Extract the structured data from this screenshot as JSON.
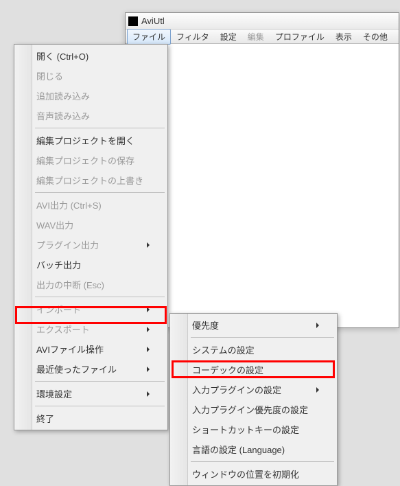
{
  "app": {
    "title": "AviUtl"
  },
  "menubar": {
    "file": "ファイル",
    "filter": "フィルタ",
    "settings": "設定",
    "edit": "編集",
    "profile": "プロファイル",
    "view": "表示",
    "other": "その他"
  },
  "menu1": {
    "open": "開く (Ctrl+O)",
    "close": "閉じる",
    "addload": "追加読み込み",
    "audioload": "音声読み込み",
    "projopen": "編集プロジェクトを開く",
    "projsave": "編集プロジェクトの保存",
    "projoverwrite": "編集プロジェクトの上書き",
    "aviout": "AVI出力 (Ctrl+S)",
    "wavout": "WAV出力",
    "pluginout": "プラグイン出力",
    "batchout": "バッチ出力",
    "abort": "出力の中断 (Esc)",
    "import": "インポート",
    "export": "エクスポート",
    "avifile": "AVIファイル操作",
    "recent": "最近使ったファイル",
    "envsettings": "環境設定",
    "exit": "終了"
  },
  "menu2": {
    "priority": "優先度",
    "system": "システムの設定",
    "codec": "コーデックの設定",
    "inputplugin": "入力プラグインの設定",
    "inputpriority": "入力プラグイン優先度の設定",
    "shortcut": "ショートカットキーの設定",
    "language": "言語の設定 (Language)",
    "windowreset": "ウィンドウの位置を初期化"
  }
}
